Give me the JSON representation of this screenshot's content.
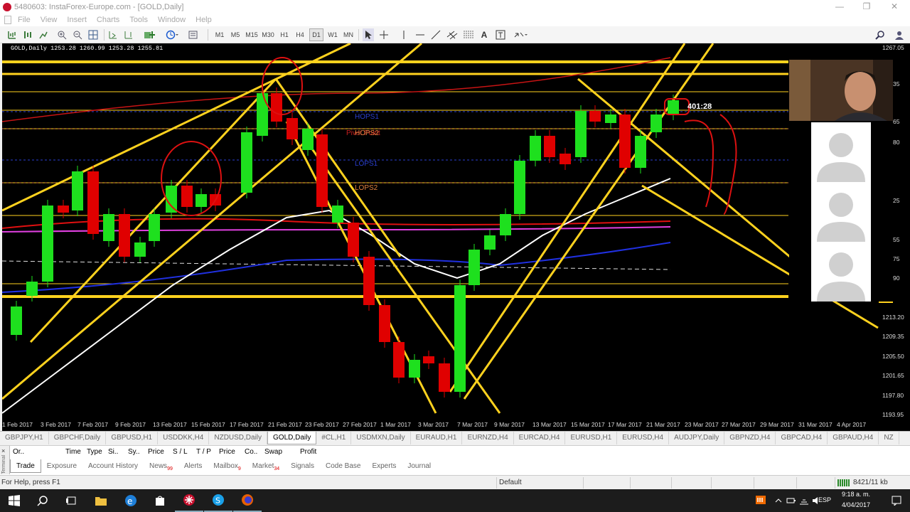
{
  "window": {
    "title": "5480603: InstaForex-Europe.com - [GOLD,Daily]",
    "minimize": "—",
    "restore": "❐",
    "close": "✕"
  },
  "menu": {
    "items": [
      "File",
      "View",
      "Insert",
      "Charts",
      "Tools",
      "Window",
      "Help"
    ],
    "inactive_color": "#aaaaaa"
  },
  "toolbar": {
    "timeframes": [
      "M1",
      "M5",
      "M15",
      "M30",
      "H1",
      "H4",
      "D1",
      "W1",
      "MN"
    ],
    "active_timeframe": "D1",
    "icons": [
      "new-chart-icon",
      "market-watch-icon",
      "data-window-icon",
      "navigator-icon",
      "zoom-in-icon",
      "zoom-out-icon",
      "tile-windows-icon",
      "scroll-chart-icon",
      "chart-shift-icon",
      "indicators-icon",
      "periods-icon",
      "templates-icon",
      "cursor-icon",
      "crosshair-icon",
      "vertical-line-icon",
      "horizontal-line-icon",
      "trendline-icon",
      "equidistant-channel-icon",
      "fibonacci-icon",
      "text-icon",
      "text-label-icon",
      "arrows-icon",
      "search-icon",
      "account-icon"
    ]
  },
  "chart": {
    "symbol_info": "GOLD,Daily  1253.28 1260.99 1253.28 1255.81",
    "background": "#000000",
    "bull_color": "#1ee01e",
    "bear_color": "#e00000",
    "trendline_color": "#ffd21e",
    "annotation_color": "#dd1111",
    "labels": [
      {
        "text": "HOPS1",
        "color": "#2a3fd0"
      },
      {
        "text": "HOPS2",
        "color": "#e08040"
      },
      {
        "text": "Pivot Point",
        "color": "#c82020"
      },
      {
        "text": "LOPS1",
        "color": "#2a3fd0"
      },
      {
        "text": "LOPS2",
        "color": "#e08040"
      }
    ],
    "countdown": "401:28",
    "price_ticks": [
      "1267.05",
      "1213.20",
      "1209.35",
      "1205.50",
      "1201.65",
      "1197.80",
      "1193.95"
    ],
    "price_ticks_partial": [
      "45",
      "78",
      "35",
      "45",
      "81",
      "65",
      "40",
      "80",
      "49",
      "25",
      "05",
      "55",
      "75",
      "90",
      "51",
      "85"
    ],
    "date_ticks": [
      "1 Feb 2017",
      "3 Feb 2017",
      "7 Feb 2017",
      "9 Feb 2017",
      "13 Feb 2017",
      "15 Feb 2017",
      "17 Feb 2017",
      "21 Feb 2017",
      "23 Feb 2017",
      "27 Feb 2017",
      "1 Mar 2017",
      "3 Mar 2017",
      "7 Mar 2017",
      "9 Mar 2017",
      "13 Mar 2017",
      "15 Mar 2017",
      "17 Mar 2017",
      "21 Mar 2017",
      "23 Mar 2017",
      "27 Mar 2017",
      "29 Mar 2017",
      "31 Mar 2017",
      "4 Apr 2017"
    ]
  },
  "chart_tabs": {
    "items": [
      "GBPJPY,H1",
      "GBPCHF,Daily",
      "GBPUSD,H1",
      "USDDKK,H4",
      "NZDUSD,Daily",
      "GOLD,Daily",
      "#CL,H1",
      "USDMXN,Daily",
      "EURAUD,H1",
      "EURNZD,H4",
      "EURCAD,H4",
      "EURUSD,H1",
      "EURUSD,H4",
      "AUDJPY,Daily",
      "GBPNZD,H4",
      "GBPCAD,H4",
      "GBPAUD,H4",
      "NZ"
    ],
    "active": "GOLD,Daily"
  },
  "terminal": {
    "close": "×",
    "side_label": "Terminal",
    "columns": [
      "Or..",
      "Time",
      "Type",
      "Si..",
      "Sy..",
      "Price",
      "S / L",
      "T / P",
      "Price",
      "Co..",
      "Swap",
      "Profit"
    ],
    "tabs": [
      {
        "label": "Trade",
        "badge": ""
      },
      {
        "label": "Exposure",
        "badge": ""
      },
      {
        "label": "Account History",
        "badge": ""
      },
      {
        "label": "News",
        "badge": "99"
      },
      {
        "label": "Alerts",
        "badge": ""
      },
      {
        "label": "Mailbox",
        "badge": "9"
      },
      {
        "label": "Market",
        "badge": "34"
      },
      {
        "label": "Signals",
        "badge": ""
      },
      {
        "label": "Code Base",
        "badge": ""
      },
      {
        "label": "Experts",
        "badge": ""
      },
      {
        "label": "Journal",
        "badge": ""
      }
    ],
    "active_tab": "Trade"
  },
  "status": {
    "help": "For Help, press F1",
    "profile": "Default",
    "traffic": "8421/11 kb"
  },
  "taskbar": {
    "icons": [
      "windows-start-icon",
      "search-icon",
      "task-view-icon",
      "file-explorer-icon",
      "edge-browser-icon",
      "store-icon",
      "instaforex-icon",
      "skype-icon",
      "firefox-icon"
    ],
    "tray_lang": "ESP",
    "time": "9:18 a. m.",
    "date": "4/04/2017"
  }
}
